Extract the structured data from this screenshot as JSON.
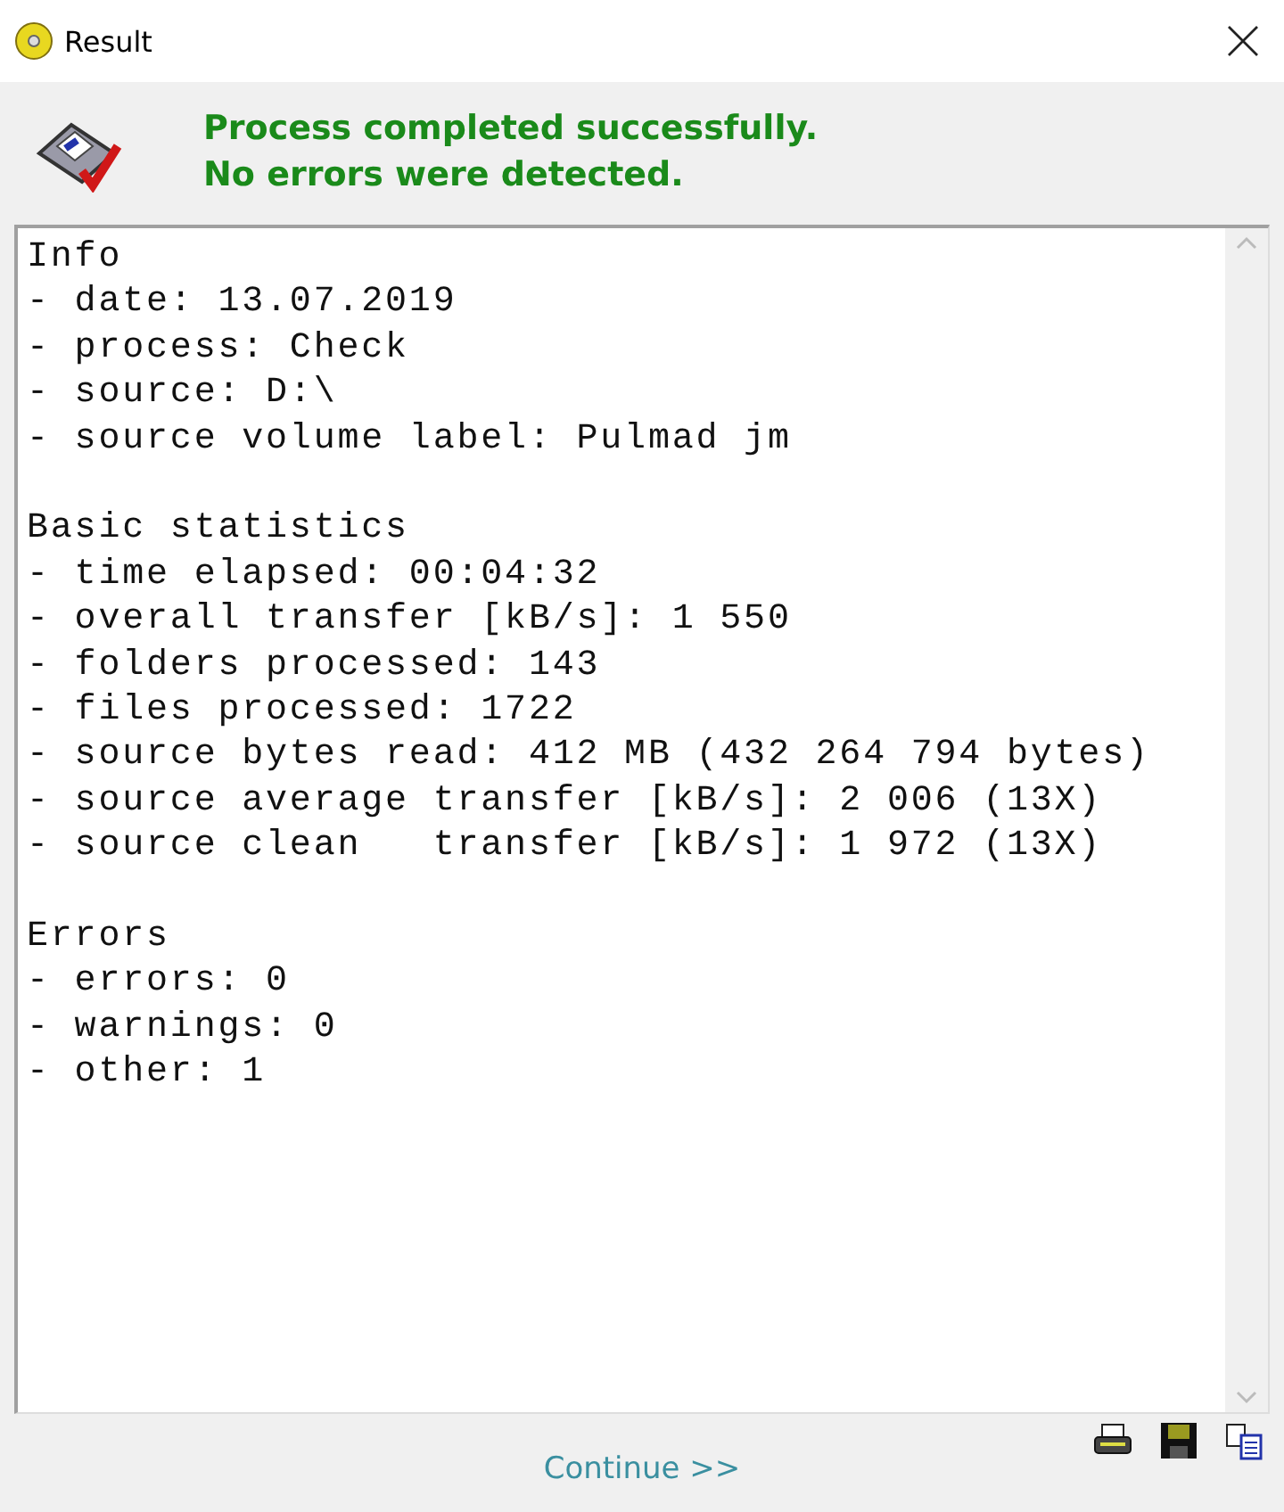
{
  "window": {
    "title": "Result"
  },
  "header": {
    "messages": [
      "Process completed successfully.",
      "No errors were detected."
    ]
  },
  "report": {
    "sections": [
      {
        "heading": "Info",
        "lines": [
          "- date: 13.07.2019",
          "- process: Check",
          "- source: D:\\",
          "- source volume label: Pulmad jm"
        ]
      },
      {
        "heading": "Basic statistics",
        "lines": [
          "- time elapsed: 00:04:32",
          "- overall transfer [kB/s]: 1 550",
          "- folders processed: 143",
          "- files processed: 1722",
          "- source bytes read: 412 MB (432 264 794 bytes)",
          "- source average transfer [kB/s]: 2 006 (13X)",
          "- source clean   transfer [kB/s]: 1 972 (13X)"
        ]
      },
      {
        "heading": "Errors",
        "lines": [
          "- errors: 0",
          "- warnings: 0",
          "- other: 1"
        ]
      }
    ]
  },
  "footer": {
    "continue": "Continue >>"
  }
}
